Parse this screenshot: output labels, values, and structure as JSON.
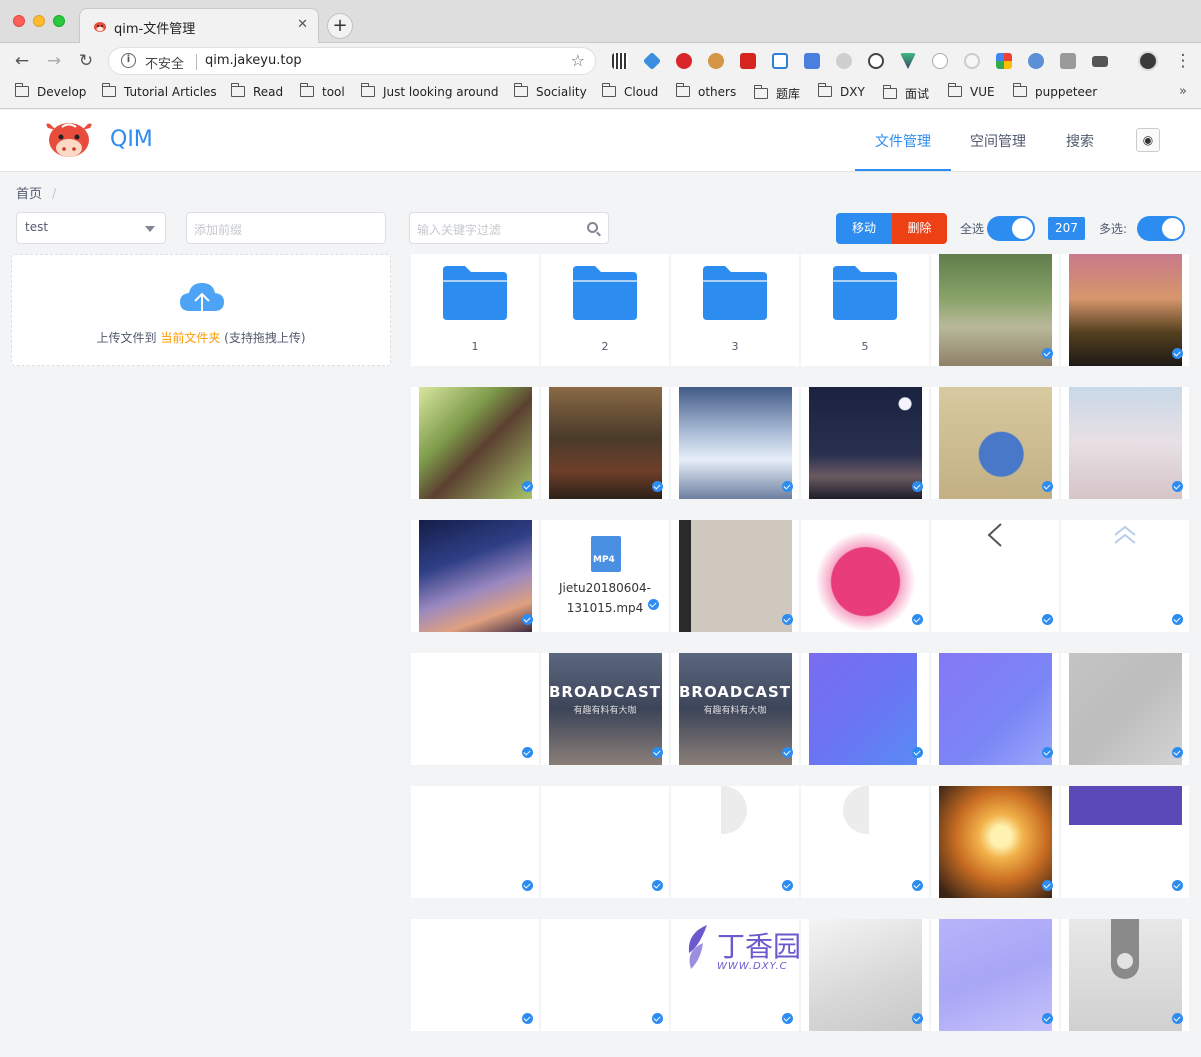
{
  "browser": {
    "tab_title": "qim-文件管理",
    "insecure_label": "不安全",
    "url": "qim.jakeyu.top",
    "bookmarks": [
      "Develop",
      "Tutorial Articles",
      "Read",
      "tool",
      "Just looking around",
      "Sociality",
      "Cloud",
      "others",
      "题库",
      "DXY",
      "面试",
      "VUE",
      "puppeteer"
    ]
  },
  "app": {
    "brand": "QIM",
    "nav": [
      "文件管理",
      "空间管理",
      "搜索"
    ],
    "active_nav": "文件管理",
    "breadcrumb": "首页",
    "bucket_select": "test",
    "prefix_placeholder": "添加前缀",
    "upload_text_before": "上传文件到 ",
    "upload_link": "当前文件夹",
    "upload_text_after": " (支持拖拽上传)",
    "filter_placeholder": "输入关键字过滤",
    "move_button": "移动",
    "delete_button": "删除",
    "select_all_label": "全选",
    "count": "207",
    "multi_select_label": "多选:",
    "select_all_on": true,
    "multi_select_on": true
  },
  "folders": [
    "1",
    "2",
    "3",
    "5"
  ],
  "video_file": {
    "badge": "MP4",
    "name_line1": "Jietu20180604-",
    "name_line2": "131015.mp4"
  },
  "broadcast": {
    "title": "BROADCAST",
    "subtitle": "有趣有料有大咖"
  },
  "dxy_logo": {
    "text": "丁香园",
    "url": "WWW.DXY.C"
  },
  "colors": {
    "primary": "#2d8cf0",
    "danger": "#ed4014",
    "link": "#ff9900"
  }
}
